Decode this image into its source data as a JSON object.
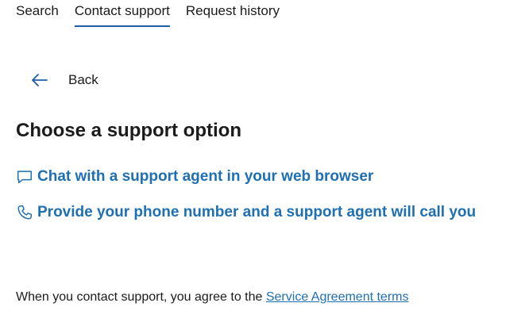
{
  "tabs": [
    {
      "label": "Search",
      "active": false
    },
    {
      "label": "Contact support",
      "active": true
    },
    {
      "label": "Request history",
      "active": false
    }
  ],
  "back": {
    "label": "Back",
    "icon": "arrow-left-icon"
  },
  "heading": "Choose a support option",
  "options": [
    {
      "label": "Chat with a support agent in your web browser",
      "icon": "chat-bubble-icon"
    },
    {
      "label": "Provide your phone number and a support agent will call you",
      "icon": "phone-icon"
    }
  ],
  "footer": {
    "text": "When you contact support, you agree to the ",
    "link": "Service Agreement terms"
  },
  "colors": {
    "accent": "#1f6fb3",
    "tab_underline": "#1f5fa8",
    "text": "#1b1b1b"
  }
}
